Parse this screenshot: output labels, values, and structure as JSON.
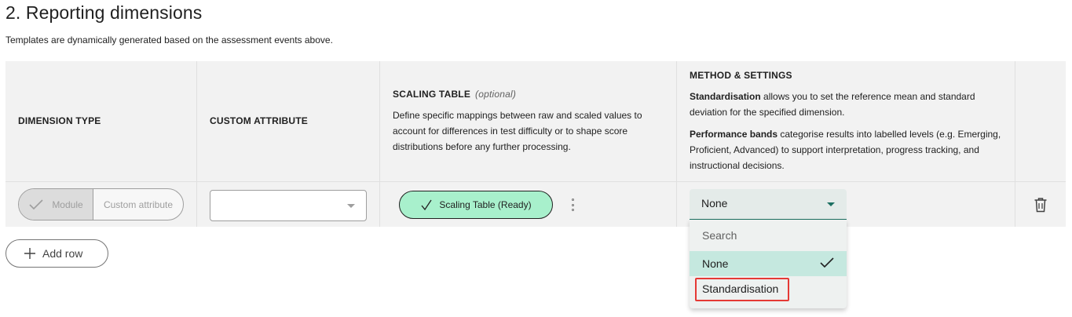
{
  "header": {
    "title": "2. Reporting dimensions",
    "subtitle": "Templates are dynamically generated based on the assessment events above."
  },
  "table": {
    "columns": {
      "dimension_type": "DIMENSION TYPE",
      "custom_attribute": "CUSTOM ATTRIBUTE",
      "scaling_table": {
        "label": "SCALING TABLE",
        "optional": "(optional)",
        "description": "Define specific mappings between raw and scaled values to account for differences in test difficulty or to shape score distributions before any further processing."
      },
      "method": {
        "label": "METHOD & SETTINGS",
        "standardisation_term": "Standardisation",
        "standardisation_text": " allows you to set the reference mean and standard deviation for the specified dimension.",
        "bands_term": "Performance bands",
        "bands_text": " categorise results into labelled levels (e.g. Emerging, Proficient, Advanced) to support interpretation, progress tracking, and instructional decisions."
      }
    },
    "row": {
      "dimension_toggle": {
        "selected": "Module",
        "unselected": "Custom attribute"
      },
      "custom_attribute_value": "",
      "scaling_chip": "Scaling Table (Ready)",
      "method_value": "None"
    }
  },
  "actions": {
    "add_row": "Add row"
  },
  "dropdown": {
    "search_placeholder": "Search",
    "options": [
      "None",
      "Standardisation"
    ],
    "selected": "None"
  },
  "colors": {
    "chip_fill": "#a8f0cc",
    "accent": "#1b6f61",
    "selected_option": "#c5e8df",
    "highlight": "#e53935"
  },
  "icons": [
    "check-icon",
    "chevron-down-icon",
    "kebab-menu-icon",
    "trash-icon",
    "plus-icon"
  ]
}
